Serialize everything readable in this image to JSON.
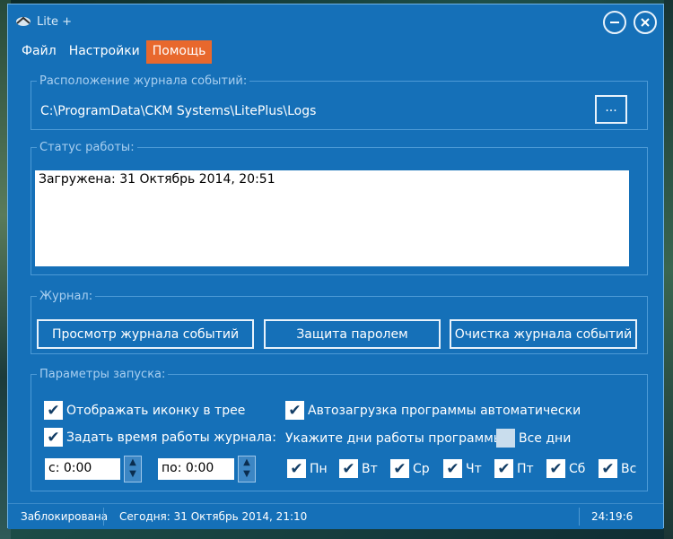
{
  "window": {
    "title": "Lite +"
  },
  "menu": [
    "Файл",
    "Настройки",
    "Помощь"
  ],
  "log_location": {
    "legend": "Расположение журнала событий:",
    "path": "C:\\ProgramData\\CKM Systems\\LitePlus\\Logs",
    "browse_label": "..."
  },
  "work_status": {
    "legend": "Статус работы:",
    "text": "Загружена: 31 Октябрь 2014, 20:51"
  },
  "journal": {
    "legend": "Журнал:",
    "view_label": "Просмотр журнала событий",
    "password_label": "Защита паролем",
    "clear_label": "Очистка журнала событий"
  },
  "startup": {
    "legend": "Параметры запуска:",
    "tray_icon_label": "Отображать иконку в трее",
    "tray_icon_checked": true,
    "set_time_label": "Задать время работы журнала:",
    "set_time_checked": true,
    "autostart_label": "Автозагрузка программы автоматически",
    "autostart_checked": true,
    "days_label": "Укажите дни работы программы:",
    "all_days_label": "Все дни",
    "all_days_checked": false,
    "from_time": "с: 0:00",
    "to_time": "по: 0:00",
    "days": [
      {
        "label": "Пн",
        "checked": true
      },
      {
        "label": "Вт",
        "checked": true
      },
      {
        "label": "Ср",
        "checked": true
      },
      {
        "label": "Чт",
        "checked": true
      },
      {
        "label": "Пт",
        "checked": true
      },
      {
        "label": "Сб",
        "checked": true
      },
      {
        "label": "Вс",
        "checked": true
      }
    ]
  },
  "statusbar": {
    "state": "Заблокирована",
    "today": "Сегодня: 31 Октябрь 2014, 21:10",
    "clock": "24:19:6"
  },
  "colors": {
    "window_bg": "#1570b8",
    "menu_active": "#e8682d"
  }
}
